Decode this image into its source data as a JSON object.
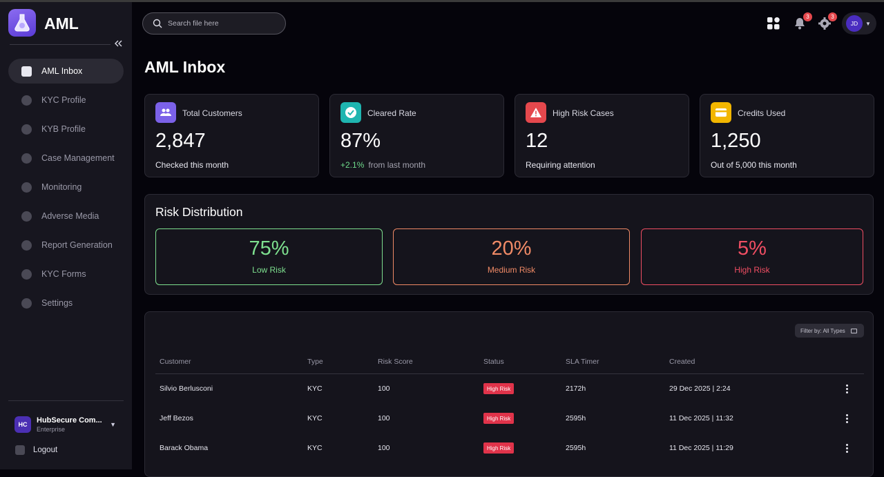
{
  "app": {
    "name": "AML"
  },
  "sidebar": {
    "items": [
      {
        "label": "AML Inbox"
      },
      {
        "label": "KYC Profile"
      },
      {
        "label": "KYB Profile"
      },
      {
        "label": "Case Management"
      },
      {
        "label": "Monitoring"
      },
      {
        "label": "Adverse Media"
      },
      {
        "label": "Report Generation"
      },
      {
        "label": "KYC Forms"
      },
      {
        "label": "Settings"
      }
    ],
    "org": {
      "initials": "HC",
      "name": "HubSecure Com...",
      "plan": "Enterprise"
    },
    "logout_label": "Logout"
  },
  "header": {
    "search_placeholder": "Search file here",
    "notifications_count": "3",
    "settings_count": "3",
    "user_initials": "JD"
  },
  "page": {
    "title": "AML Inbox"
  },
  "stats": [
    {
      "title": "Total Customers",
      "value": "2,847",
      "sub": "Checked this month",
      "icon": "users-icon",
      "color": "#7b61e8"
    },
    {
      "title": "Cleared Rate",
      "value": "87%",
      "sub_change": "+2.1%",
      "sub": "from last month",
      "icon": "check-badge-icon",
      "color": "#1fb5b0"
    },
    {
      "title": "High Risk Cases",
      "value": "12",
      "sub": "Requiring attention",
      "icon": "warning-icon",
      "color": "#e5484d"
    },
    {
      "title": "Credits Used",
      "value": "1,250",
      "sub": "Out of 5,000 this month",
      "icon": "credit-card-icon",
      "color": "#f2b600"
    }
  ],
  "risk": {
    "title": "Risk Distribution",
    "items": [
      {
        "pct": "75%",
        "label": "Low Risk",
        "color": "#7ee08f"
      },
      {
        "pct": "20%",
        "label": "Medium Risk",
        "color": "#f08a66"
      },
      {
        "pct": "5%",
        "label": "High Risk",
        "color": "#f04e63"
      }
    ]
  },
  "table": {
    "filter_label": "Filter by: All Types",
    "columns": [
      "Customer",
      "Type",
      "Risk Score",
      "Status",
      "SLA Timer",
      "Created"
    ],
    "rows": [
      {
        "customer": "Silvio Berlusconi",
        "type": "KYC",
        "score": "100",
        "status": "High Risk",
        "sla": "2172h",
        "created": "29 Dec 2025 | 2:24"
      },
      {
        "customer": "Jeff Bezos",
        "type": "KYC",
        "score": "100",
        "status": "High Risk",
        "sla": "2595h",
        "created": "11 Dec 2025 | 11:32"
      },
      {
        "customer": "Barack Obama",
        "type": "KYC",
        "score": "100",
        "status": "High Risk",
        "sla": "2595h",
        "created": "11 Dec 2025 | 11:29"
      }
    ]
  }
}
